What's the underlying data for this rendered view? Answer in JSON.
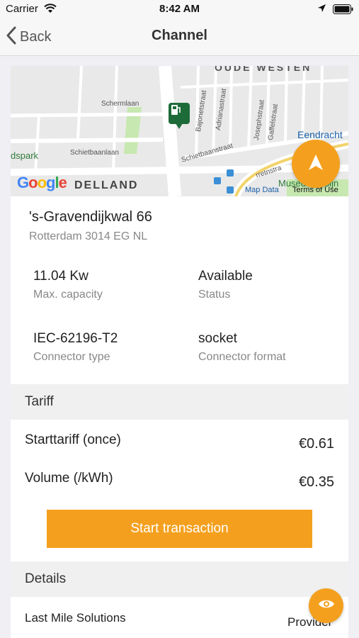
{
  "status_bar": {
    "carrier": "Carrier",
    "time": "8:42 AM"
  },
  "nav": {
    "back_label": "Back",
    "title": "Channel"
  },
  "map": {
    "labels": {
      "district_top": "OUDE WESTEN",
      "schermlaan": "Schermlaan",
      "bajonetstraat": "Bajonetstraat",
      "adrianastraat": "Adrianastraat",
      "josephstraat": "Josephstraat",
      "gaffelstraat": "Gaffelstraat",
      "schietbaanstraat": "Schietbaanstraat",
      "schietbaanlaan": "Schietbaanlaan",
      "park": "dspark",
      "eendracht": "Eendracht",
      "area": "DELLAND",
      "museum": "Museu",
      "museum_tail": "oijn",
      "street_right": "rretnstra"
    },
    "google_logo": "Google",
    "map_data": "Map Data",
    "terms": "Terms of Use"
  },
  "address": {
    "street": "'s-Gravendijkwal 66",
    "city_line": "Rotterdam 3014 EG NL"
  },
  "info": {
    "capacity_value": "11.04 Kw",
    "capacity_label": "Max. capacity",
    "status_value": "Available",
    "status_label": "Status",
    "connector_value": "IEC-62196-T2",
    "connector_label": "Connector type",
    "format_value": "socket",
    "format_label": "Connector format"
  },
  "tariff": {
    "heading": "Tariff",
    "rows": [
      {
        "label": "Starttariff (once)",
        "value": "€0.61"
      },
      {
        "label": "Volume (/kWh)",
        "value": "€0.35"
      }
    ],
    "start_button": "Start transaction"
  },
  "details": {
    "heading": "Details",
    "name": "Last Mile Solutions",
    "role": "Provider"
  },
  "colors": {
    "accent": "#f4a01e",
    "pin": "#1e6b3a",
    "section_bg": "#f0f0f0",
    "page_bg": "#efeff4"
  },
  "icons": {
    "back": "chevron-left-icon",
    "wifi": "wifi-icon",
    "location": "location-arrow-icon",
    "battery": "battery-icon",
    "pin": "charging-station-icon",
    "navigate": "navigation-arrow-icon",
    "eye": "eye-icon"
  }
}
